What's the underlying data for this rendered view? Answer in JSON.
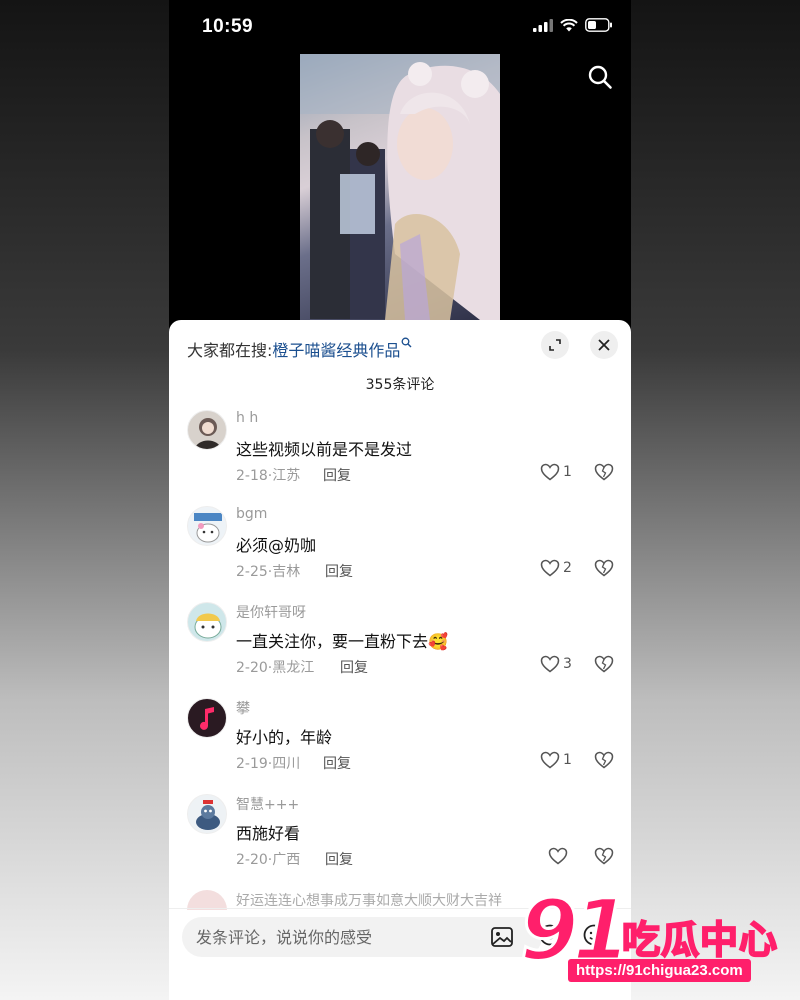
{
  "status": {
    "time": "10:59"
  },
  "hot_search": {
    "prefix": "大家都在搜:",
    "term": "橙子喵酱经典作品",
    "icon": "search-small-icon"
  },
  "comment_count": "355条评论",
  "comments": [
    {
      "user": "h h",
      "text": "这些视频以前是不是发过",
      "date": "2-18",
      "location": "江苏",
      "reply": "回复",
      "likes": "1",
      "avatar_color": "#6b5a55"
    },
    {
      "user": "bgm",
      "text": "必须@奶咖",
      "date": "2-25",
      "location": "吉林",
      "reply": "回复",
      "likes": "2",
      "avatar_color": "#dfe9f2"
    },
    {
      "user": "是你轩哥呀",
      "text": "一直关注你，要一直粉下去🥰",
      "date": "2-20",
      "location": "黑龙江",
      "reply": "回复",
      "likes": "3",
      "avatar_color": "#cfe7ea"
    },
    {
      "user": "攀",
      "text": "好小的，年龄",
      "date": "2-19",
      "location": "四川",
      "reply": "回复",
      "likes": "1",
      "avatar_color": "#2a1a22"
    },
    {
      "user": "智慧+++",
      "text": "西施好看",
      "date": "2-20",
      "location": "广西",
      "reply": "回复",
      "likes": "",
      "avatar_color": "#e8eef3"
    }
  ],
  "partial_comment": {
    "user": "好运连连心想事成万事如意大顺大财大吉祥"
  },
  "input": {
    "placeholder": "发条评论，说说你的感受"
  },
  "watermark": {
    "number": "91",
    "name": "吃瓜中心",
    "url": "https://91chigua23.com"
  },
  "colors": {
    "link": "#1b4f8f",
    "brand": "#ff1f6b"
  }
}
